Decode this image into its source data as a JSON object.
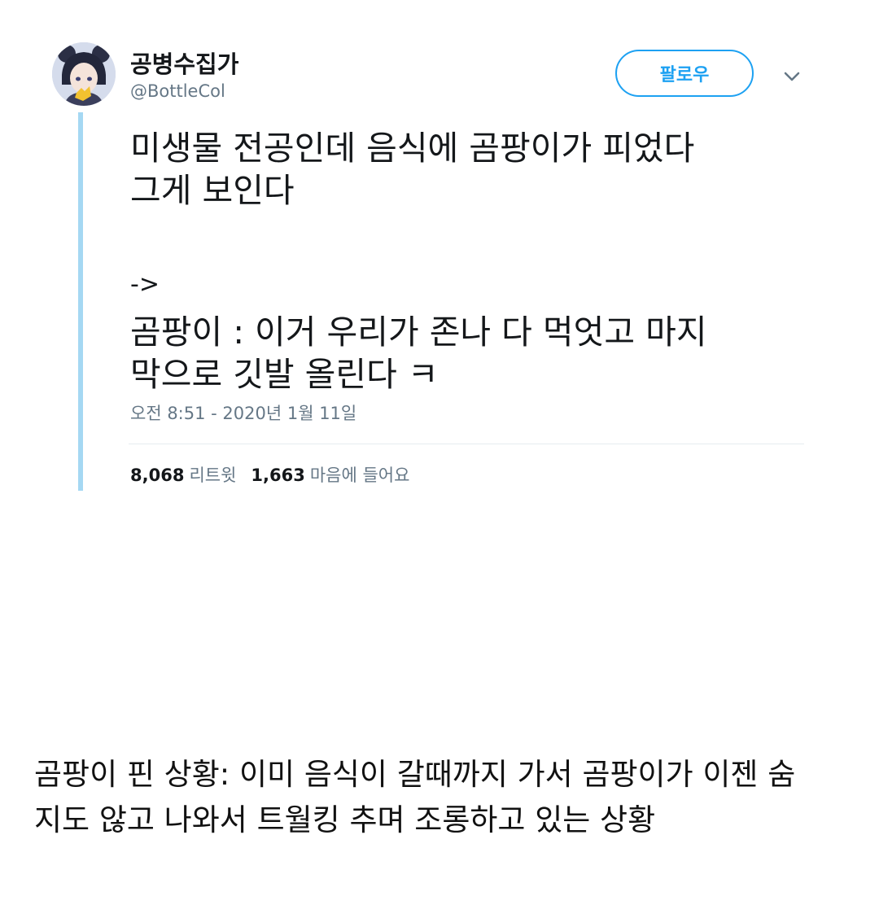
{
  "tweet": {
    "display_name": "공병수집가",
    "handle": "@BottleCol",
    "follow_label": "팔로우",
    "text_lines_1": [
      "미생물 전공인데 음식에 곰팡이가 피었다",
      "그게 보인다"
    ],
    "arrow": "->",
    "text_lines_2": [
      "곰팡이 : 이거 우리가 존나 다 먹엇고 마지",
      "막으로 깃발 올린다 ㅋ"
    ],
    "timestamp": "오전 8:51 - 2020년 1월 11일",
    "retweets_count": "8,068",
    "retweets_label": "리트윗",
    "likes_count": "1,663",
    "likes_label": "마음에 들어요"
  },
  "caption": {
    "lines": [
      "곰팡이 핀 상황: 이미 음식이 갈때까지 가서 곰팡이가 이젠 숨",
      "지도 않고 나와서 트월킹 추며 조롱하고 있는 상황"
    ]
  },
  "colors": {
    "accent": "#1da1f2",
    "thread_line": "#a5d8f3",
    "secondary_text": "#657786",
    "divider": "#e6ecf0"
  },
  "icons": {
    "avatar": "anime-character-avatar",
    "more": "chevron-down-icon"
  }
}
